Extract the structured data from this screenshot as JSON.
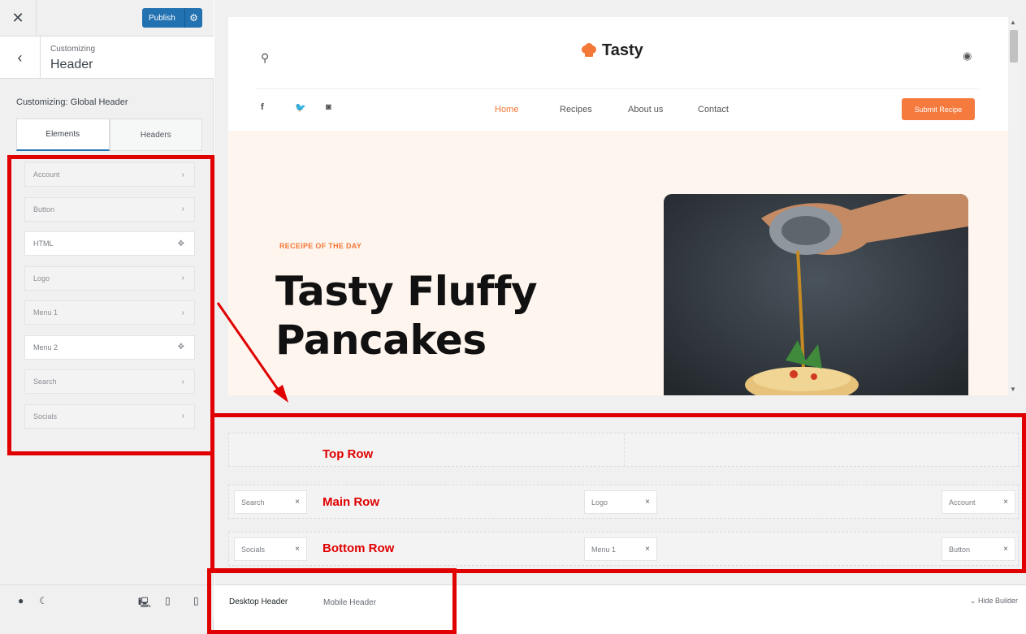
{
  "sidebar": {
    "close_icon": "close-icon",
    "publish_label": "Publish",
    "section_small": "Customizing",
    "section_big": "Header",
    "customizing_title": "Customizing: Global Header",
    "tabs": [
      {
        "label": "Elements"
      },
      {
        "label": "Headers"
      }
    ],
    "elements": [
      {
        "label": "Account",
        "icon": "chevron-right"
      },
      {
        "label": "Button",
        "icon": "chevron-right"
      },
      {
        "label": "HTML",
        "icon": "move"
      },
      {
        "label": "Logo",
        "icon": "chevron-right"
      },
      {
        "label": "Menu 1",
        "icon": "chevron-right"
      },
      {
        "label": "Menu 2",
        "icon": "move"
      },
      {
        "label": "Search",
        "icon": "chevron-right"
      },
      {
        "label": "Socials",
        "icon": "chevron-right"
      }
    ]
  },
  "preview": {
    "logo_text": "Tasty",
    "nav": [
      "Home",
      "Recipes",
      "About us",
      "Contact"
    ],
    "submit_label": "Submit Recipe",
    "hero_sub": "RECEIPE OF THE DAY",
    "hero_title_1": "Tasty Fluffy",
    "hero_title_2": "Pancakes",
    "accent_color": "#f37736"
  },
  "builder": {
    "rows": {
      "main": {
        "left": "Search",
        "center": "Logo",
        "right": "Account"
      },
      "bottom": {
        "left": "Socials",
        "center": "Menu 1",
        "right": "Button"
      }
    },
    "labels": {
      "top": "Top Row",
      "main": "Main Row",
      "bottom": "Bottom Row"
    },
    "footer_tabs": [
      "Desktop Header",
      "Mobile Header"
    ],
    "hide_builder": "Hide Builder",
    "chip_close": "×"
  },
  "icons": {
    "chevron": "›",
    "move": "✥"
  }
}
